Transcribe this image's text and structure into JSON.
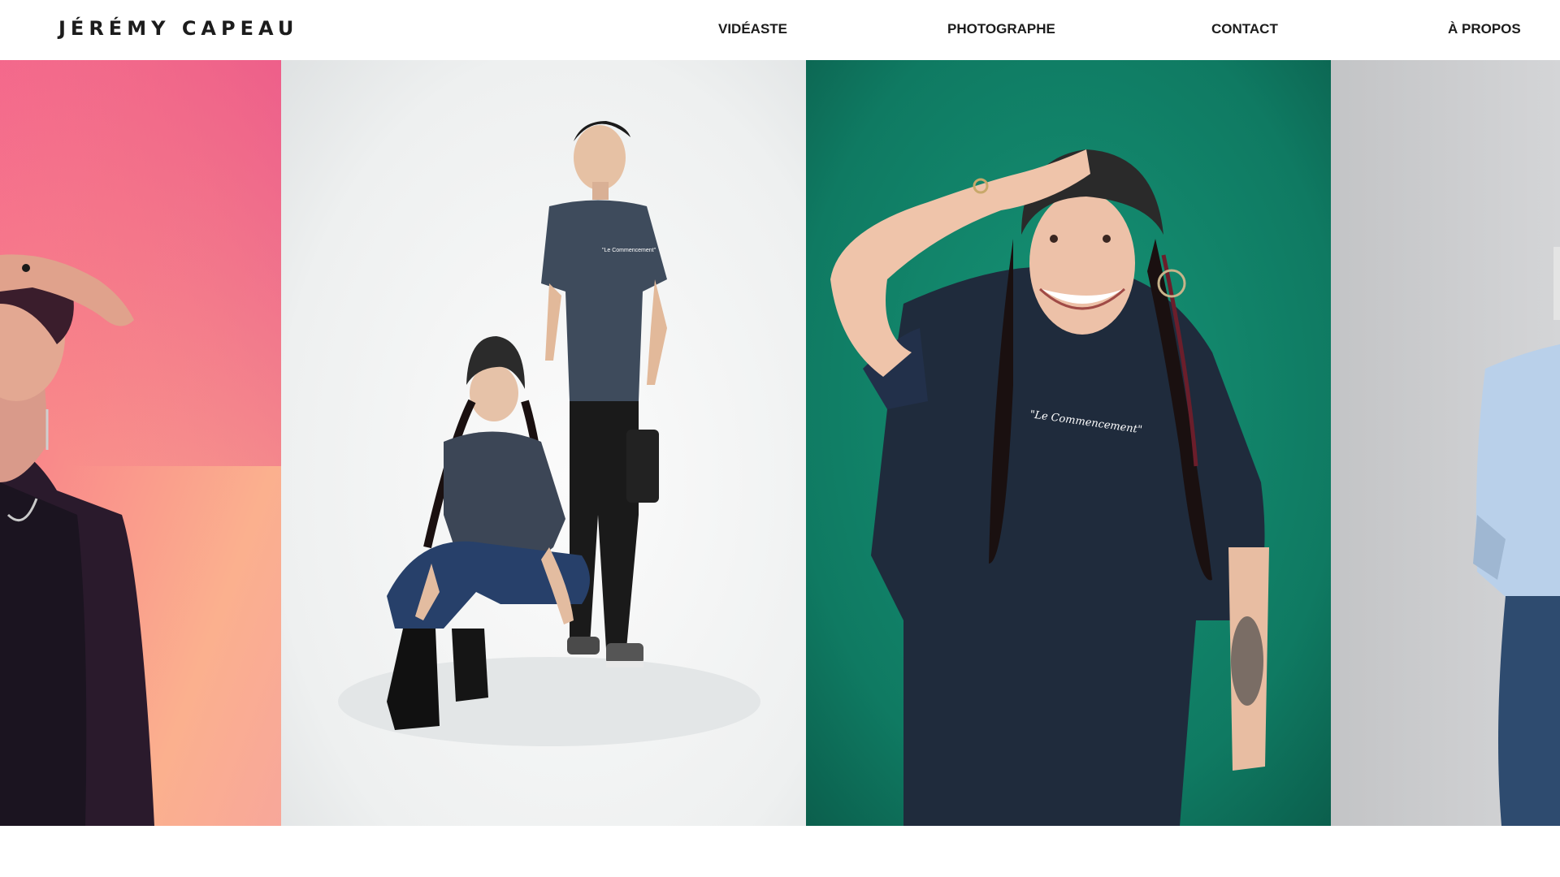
{
  "header": {
    "brand": "JÉRÉMY CAPEAU",
    "nav": [
      "VIDÉASTE",
      "PHOTOGRAPHE",
      "CONTACT",
      "À PROPOS"
    ]
  },
  "gallery": {
    "photos": [
      {
        "subject": "woman-pink-gradient-portrait",
        "background": "#ee6b8a"
      },
      {
        "subject": "two-models-white-studio",
        "background": "#f1f2f2",
        "shirt_text": "\"Le Commencement\""
      },
      {
        "subject": "woman-green-backdrop-beanie",
        "background": "#0f7a60",
        "shirt_text": "\"Le Commencement\""
      },
      {
        "subject": "person-grey-backdrop-blue-shirt",
        "background": "#c6c7ca"
      }
    ]
  },
  "colors": {
    "nav_text": "#1c1c1c",
    "page_background": "#ffffff"
  }
}
